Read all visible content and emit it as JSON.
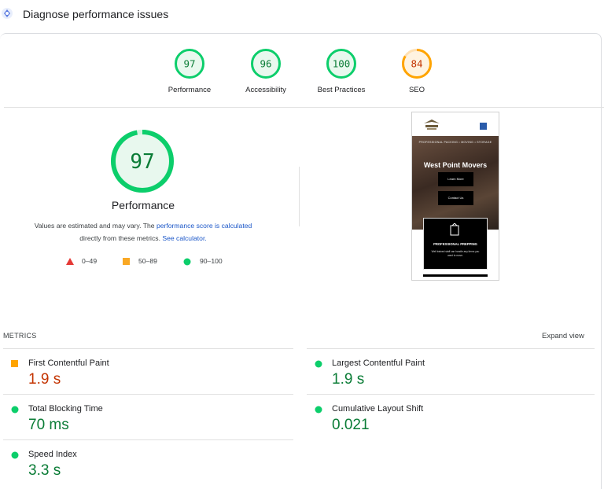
{
  "header": {
    "title": "Diagnose performance issues",
    "icon": "lighthouse-icon"
  },
  "summary_scores": [
    {
      "label": "Performance",
      "score": 97,
      "status": "pass"
    },
    {
      "label": "Accessibility",
      "score": 96,
      "status": "pass"
    },
    {
      "label": "Best Practices",
      "score": 100,
      "status": "pass"
    },
    {
      "label": "SEO",
      "score": 84,
      "status": "average"
    }
  ],
  "main_score": {
    "label": "Performance",
    "score": 97
  },
  "note": {
    "text1": "Values are estimated and may vary. The ",
    "link1": "performance score is calculated",
    "text2": "directly from these metrics. ",
    "link2": "See calculator."
  },
  "legend": [
    {
      "range": "0–49",
      "shape": "triangle",
      "color": "#e53935"
    },
    {
      "range": "50–89",
      "shape": "square",
      "color": "#f9a825"
    },
    {
      "range": "90–100",
      "shape": "circle",
      "color": "#0cce6b"
    }
  ],
  "screenshot": {
    "banner": "PROFESSIONAL PACKING • MOVING • STORAGE",
    "title": "West Point Movers",
    "button1": "Learn More",
    "button2": "Contact Us",
    "card_title": "PROFESSIONAL PREPPING",
    "card_text": "Well trained staff can handle any items you want to move."
  },
  "metrics": {
    "title": "METRICS",
    "expand_label": "Expand view",
    "items": [
      {
        "label": "First Contentful Paint",
        "value": "1.9 s",
        "status": "average"
      },
      {
        "label": "Largest Contentful Paint",
        "value": "1.9 s",
        "status": "pass"
      },
      {
        "label": "Total Blocking Time",
        "value": "70 ms",
        "status": "pass"
      },
      {
        "label": "Cumulative Layout Shift",
        "value": "0.021",
        "status": "pass"
      },
      {
        "label": "Speed Index",
        "value": "3.3 s",
        "status": "pass"
      }
    ]
  },
  "colors": {
    "pass": "#0cce6b",
    "pass_text": "#0a7c36",
    "pass_fill": "#e8f8ee",
    "average": "#ffa400",
    "average_text": "#c33300",
    "average_fill": "#fff3e0",
    "fail": "#e53935"
  }
}
